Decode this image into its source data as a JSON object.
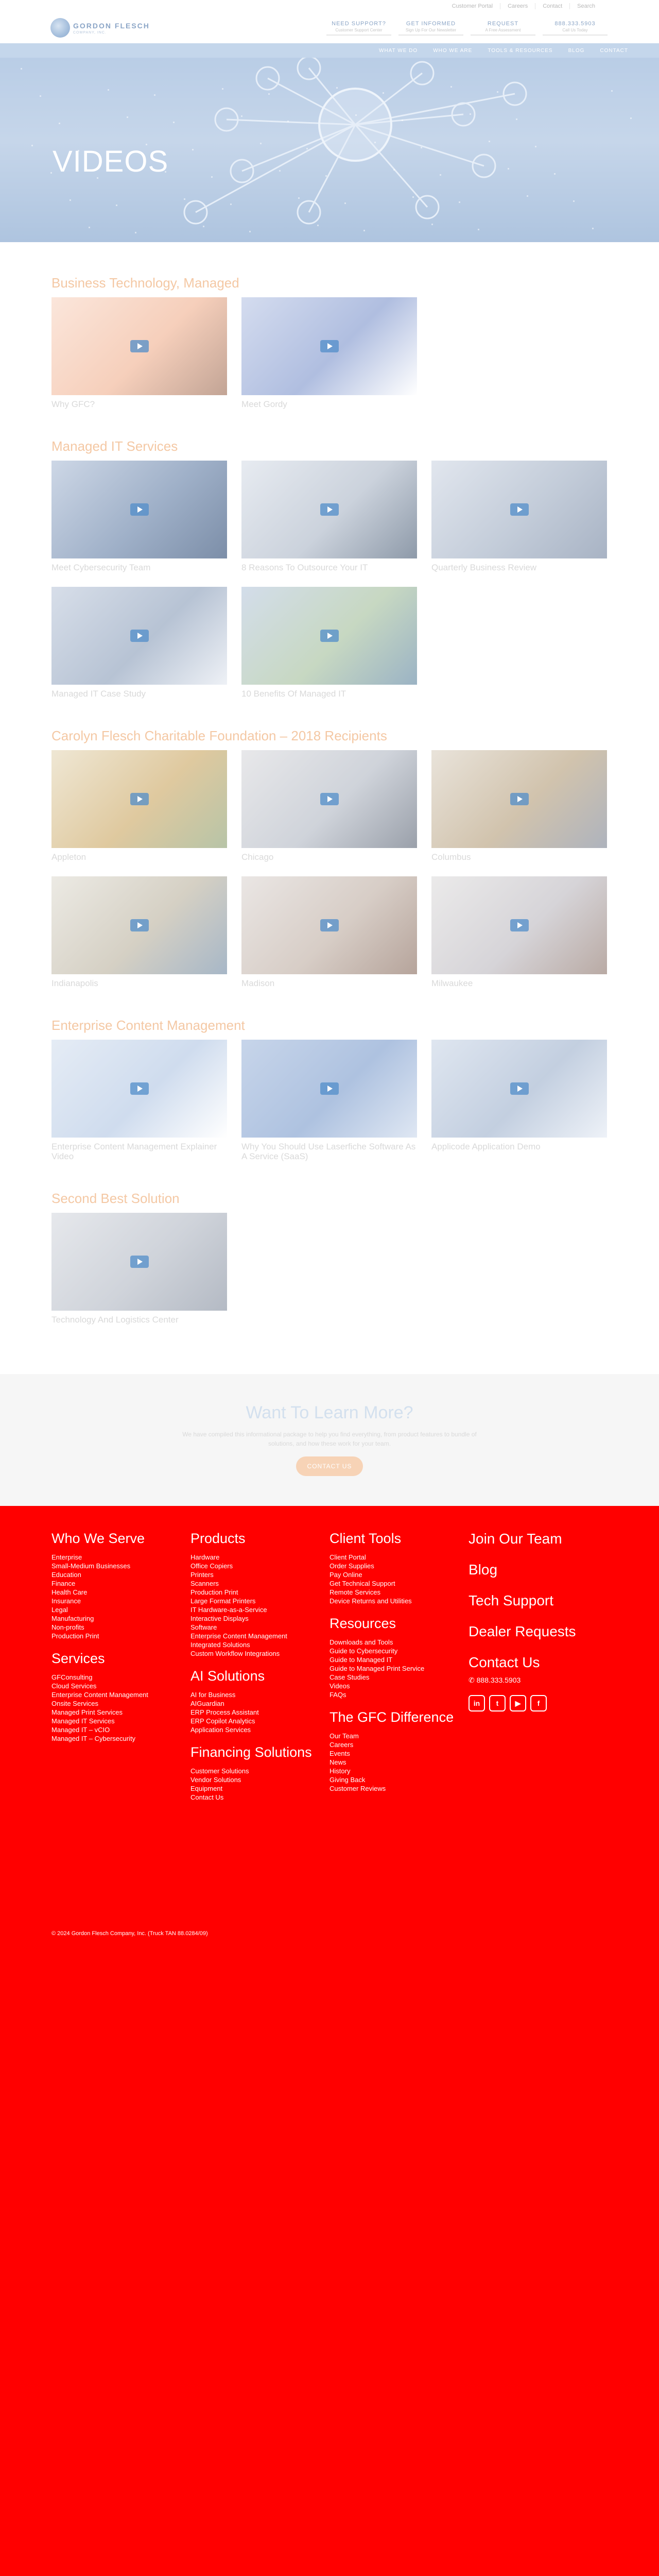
{
  "utility_links": [
    "Customer Portal",
    "Careers",
    "Contact",
    "Search"
  ],
  "logo": {
    "name": "GORDON FLESCH",
    "tagline": "COMPANY, INC."
  },
  "header_ctas": [
    {
      "title": "NEED SUPPORT?",
      "sub": "Customer Support Center"
    },
    {
      "title": "GET INFORMED",
      "sub": "Sign Up For Our Newsletter"
    },
    {
      "title": "REQUEST",
      "sub": "A Free Assessment"
    },
    {
      "title": "888.333.5903",
      "sub": "Call Us Today"
    }
  ],
  "nav": [
    "WHAT WE DO",
    "WHO WE ARE",
    "TOOLS & RESOURCES",
    "BLOG",
    "CONTACT"
  ],
  "hero": {
    "title": "VIDEOS"
  },
  "sections": [
    {
      "title": "Business Technology, Managed",
      "items": [
        {
          "label": "Why GFC?",
          "colors": [
            "#fbe6db",
            "#f6cfbb",
            "#c2a495"
          ]
        },
        {
          "label": "Meet Gordy",
          "colors": [
            "#d4dcef",
            "#b0bee0",
            "#ffffff"
          ]
        }
      ]
    },
    {
      "title": "Managed IT Services",
      "items": [
        {
          "label": "Meet Cybersecurity Team",
          "colors": [
            "#cdd7e6",
            "#9fb0c8",
            "#7c8ea8"
          ]
        },
        {
          "label": "8 Reasons To Outsource Your IT",
          "colors": [
            "#e7ebf1",
            "#cbd2dc",
            "#8e9aa9"
          ]
        },
        {
          "label": "Quarterly Business Review",
          "colors": [
            "#e1e6ee",
            "#c3ccd9",
            "#a8b3c4"
          ]
        },
        {
          "label": "Managed IT Case Study",
          "colors": [
            "#d7dee9",
            "#b7c3d4",
            "#eef1f6"
          ]
        },
        {
          "label": "10 Benefits Of Managed IT",
          "colors": [
            "#d3ddea",
            "#c7d8c2",
            "#9bb3c4"
          ]
        }
      ]
    },
    {
      "title": "Carolyn Flesch Charitable Foundation – 2018 Recipients",
      "items": [
        {
          "label": "Appleton",
          "colors": [
            "#efe7d4",
            "#dfc99f",
            "#b7c4a7"
          ]
        },
        {
          "label": "Chicago",
          "colors": [
            "#e8e8ea",
            "#cfd3da",
            "#9aa0aa"
          ]
        },
        {
          "label": "Columbus",
          "colors": [
            "#e9e3da",
            "#d1c3ad",
            "#aeb3bd"
          ]
        },
        {
          "label": "Indianapolis",
          "colors": [
            "#eceae4",
            "#d5d0c4",
            "#a7b7c7"
          ]
        },
        {
          "label": "Madison",
          "colors": [
            "#eae6e4",
            "#d7cdc6",
            "#b6a49b"
          ]
        },
        {
          "label": "Milwaukee",
          "colors": [
            "#ebeaea",
            "#d6d4d8",
            "#b9aaa4"
          ]
        }
      ]
    },
    {
      "title": "Enterprise Content Management",
      "items": [
        {
          "label": "Enterprise Content Management Explainer Video",
          "colors": [
            "#e5ecf5",
            "#cfdcee",
            "#ffffff"
          ]
        },
        {
          "label": "Why You Should Use Laserfiche Software As A Service (SaaS)",
          "colors": [
            "#c7d5ea",
            "#aec2e0",
            "#dfe7f3"
          ]
        },
        {
          "label": "Applicode Application Demo",
          "colors": [
            "#dfe6f0",
            "#c3cfe0",
            "#eef2f8"
          ]
        }
      ]
    },
    {
      "title": "Second Best Solution",
      "items": [
        {
          "label": "Technology And Logistics Center",
          "colors": [
            "#e6e8ec",
            "#cfd3da",
            "#b4bac4"
          ]
        }
      ]
    }
  ],
  "learn_more": {
    "title": "Want To Learn More?",
    "text": "We have compiled this informational package to help you find everything, from product features to bundle of solutions, and how these work for your team.",
    "button": "CONTACT US"
  },
  "footer": {
    "col1": {
      "title": "Who We Serve",
      "items": [
        "Enterprise",
        "Small-Medium Businesses",
        "Education",
        "Finance",
        "Health Care",
        "Insurance",
        "Legal",
        "Manufacturing",
        "Non-profits",
        "Production Print"
      ],
      "title2": "Services",
      "items2": [
        "GFConsulting",
        "Cloud Services",
        "Enterprise Content Management",
        "Onsite Services",
        "Managed Print Services",
        "Managed IT Services",
        "Managed IT – vCIO",
        "Managed IT – Cybersecurity"
      ]
    },
    "col2": {
      "title": "Products",
      "items": [
        "Hardware",
        "Office Copiers",
        "Printers",
        "Scanners",
        "Production Print",
        "Large Format Printers",
        "IT Hardware-as-a-Service",
        "Interactive Displays",
        "Software",
        "Enterprise Content Management",
        "Integrated Solutions",
        "Custom Workflow Integrations"
      ],
      "title2": "AI Solutions",
      "items2": [
        "AI for Business",
        "AIGuardian",
        "ERP Process Assistant",
        "ERP Copilot Analytics",
        "Application Services"
      ],
      "title3": "Financing Solutions",
      "items3": [
        "Customer Solutions",
        "Vendor Solutions",
        "Equipment",
        "Contact Us"
      ]
    },
    "col3": {
      "title": "Client Tools",
      "items": [
        "Client Portal",
        "Order Supplies",
        "Pay Online",
        "Get Technical Support",
        "Remote Services",
        "Device Returns and Utilities"
      ],
      "title2": "Resources",
      "items2": [
        "Downloads and Tools",
        "Guide to Cybersecurity",
        "Guide to Managed IT",
        "Guide to Managed Print Service",
        "Case Studies",
        "Videos",
        "FAQs"
      ],
      "title3": "The GFC Difference",
      "items3": [
        "Our Team",
        "Careers",
        "Events",
        "News",
        "History",
        "Giving Back",
        "Customer Reviews"
      ]
    },
    "col4": {
      "links": [
        "Join Our Team",
        "Blog",
        "Tech Support",
        "Dealer Requests",
        "Contact Us"
      ],
      "phone": "888.333.5903",
      "socials": [
        {
          "icon": "linkedin-icon",
          "glyph": "in"
        },
        {
          "icon": "twitter-icon",
          "glyph": "t"
        },
        {
          "icon": "youtube-icon",
          "glyph": "▶"
        },
        {
          "icon": "facebook-icon",
          "glyph": "f"
        }
      ]
    },
    "copyright": "© 2024 Gordon Flesch Company, Inc. (Truck TAN 88.0284/09)"
  }
}
